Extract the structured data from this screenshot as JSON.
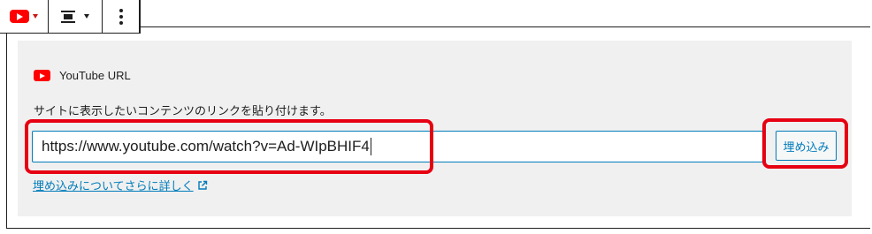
{
  "toolbar": {
    "embed_icon": "youtube-icon",
    "align_icon": "align-center-icon",
    "more_icon": "more-vertical-icon"
  },
  "placeholder": {
    "label": "YouTube URL",
    "instructions": "サイトに表示したいコンテンツのリンクを貼り付けます。",
    "input_value": "https://www.youtube.com/watch?v=Ad-WIpBHIF4",
    "embed_button": "埋め込み",
    "learn_more": "埋め込みについてさらに詳しく"
  },
  "colors": {
    "youtube_red": "#ff0000",
    "accent_blue": "#007cba",
    "highlight_red": "#e60012",
    "panel_bg": "#f0f0f0"
  }
}
